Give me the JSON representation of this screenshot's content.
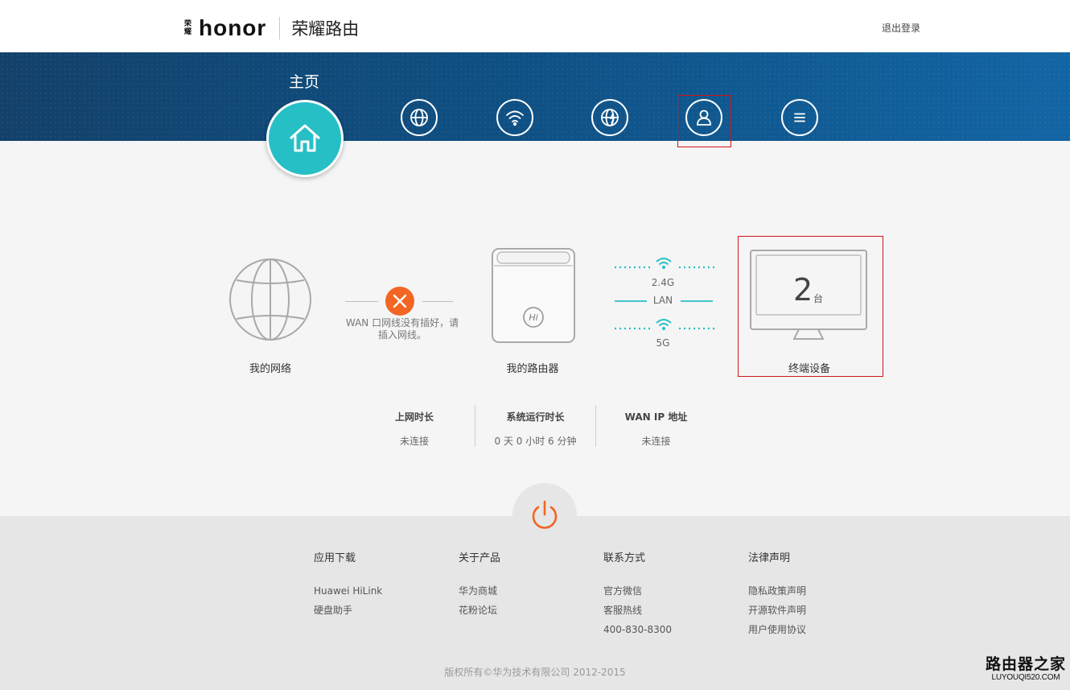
{
  "header": {
    "brand_cn": "荣耀",
    "brand": "honor",
    "product": "荣耀路由",
    "logout": "退出登录"
  },
  "nav": {
    "title": "主页",
    "items": [
      {
        "icon": "home-icon"
      },
      {
        "icon": "globe-icon"
      },
      {
        "icon": "wifi-icon"
      },
      {
        "icon": "globe-settings-icon"
      },
      {
        "icon": "user-icon"
      },
      {
        "icon": "menu-icon"
      }
    ]
  },
  "diagram": {
    "network_label": "我的网络",
    "wan_message": "WAN 口网线没有插好，请插入网线。",
    "router_label": "我的路由器",
    "router_badge": "Hi",
    "band_24": "2.4G",
    "band_lan": "LAN",
    "band_5": "5G",
    "devices_count": "2",
    "devices_unit": "台",
    "devices_label": "终端设备"
  },
  "stats": [
    {
      "title": "上网时长",
      "value": "未连接"
    },
    {
      "title": "系统运行时长",
      "value": "0 天 0 小时 6 分钟"
    },
    {
      "title": "WAN IP 地址",
      "value": "未连接"
    }
  ],
  "footer": {
    "columns": [
      {
        "title": "应用下载",
        "links": [
          "Huawei HiLink",
          "硬盘助手"
        ]
      },
      {
        "title": "关于产品",
        "links": [
          "华为商城",
          "花粉论坛"
        ]
      },
      {
        "title": "联系方式",
        "links": [
          "官方微信",
          "客服热线",
          "400-830-8300"
        ]
      },
      {
        "title": "法律声明",
        "links": [
          "隐私政策声明",
          "开源软件声明",
          "用户使用协议"
        ]
      }
    ],
    "copyright": "版权所有©华为技术有限公司 2012-2015"
  },
  "watermark": {
    "cn": "路由器之家",
    "en": "LUYOUQI520.COM"
  },
  "colors": {
    "accent_teal": "#27bfc6",
    "alert_orange": "#f26522",
    "nav_blue": "#0f4f82",
    "highlight_red": "#d0141a"
  }
}
